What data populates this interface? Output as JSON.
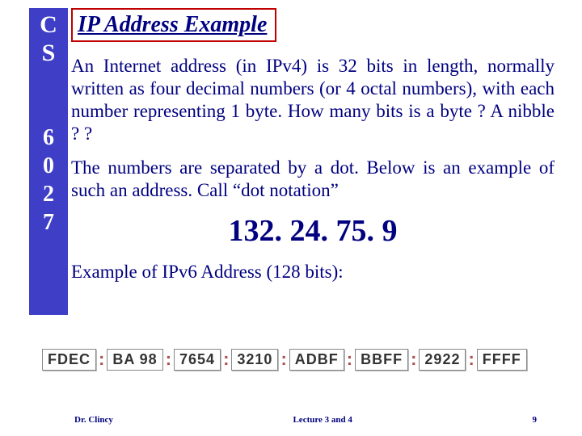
{
  "sidebar": {
    "line1": "C",
    "line2": "S",
    "line3": "6",
    "line4": "0",
    "line5": "2",
    "line6": "7"
  },
  "title": "IP Address Example",
  "para1": "An Internet address (in IPv4) is 32 bits in length, normally written as four decimal numbers (or 4 octal numbers), with each number representing 1 byte. How many bits is a byte ? A nibble ? ?",
  "para2": "The numbers are separated by a dot. Below is an example of such an address. Call “dot notation”",
  "ipv4_value": "132. 24. 75. 9",
  "ipv6_caption": "Example of IPv6 Address (128 bits):",
  "ipv6_groups": [
    "FDEC",
    "BA 98",
    "7654",
    "3210",
    "ADBF",
    "BBFF",
    "2922",
    "FFFF"
  ],
  "colon": ":",
  "footer": {
    "left": "Dr. Clincy",
    "center": "Lecture 3 and 4",
    "right": "9"
  }
}
